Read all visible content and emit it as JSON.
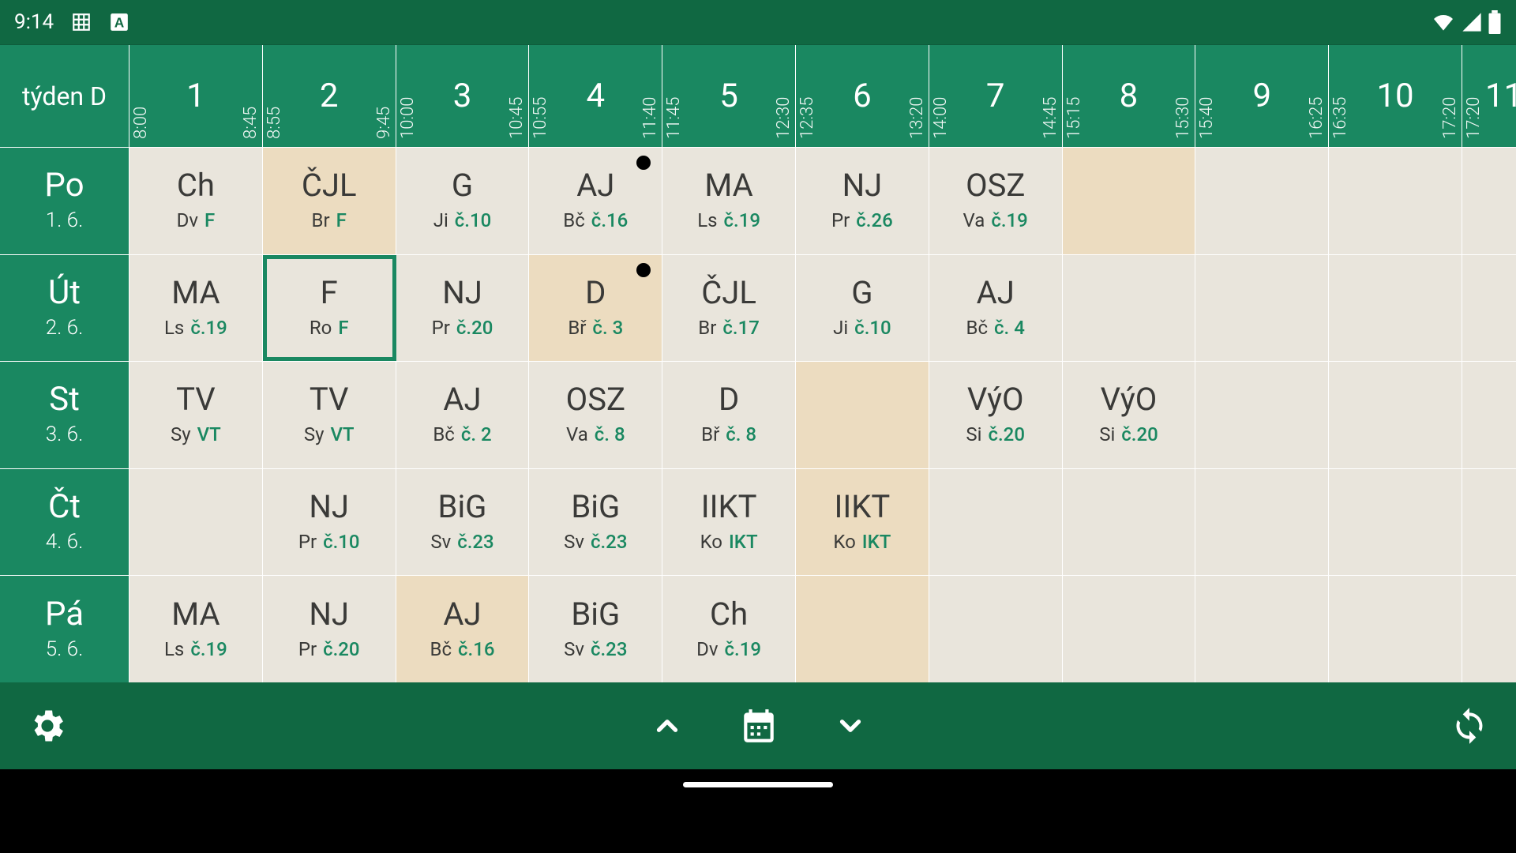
{
  "status": {
    "time": "9:14"
  },
  "header": {
    "week_label": "týden D",
    "periods": [
      {
        "num": "1",
        "start": "8:00",
        "end": "8:45",
        "narrow": false
      },
      {
        "num": "2",
        "start": "8:55",
        "end": "9:45",
        "narrow": false
      },
      {
        "num": "3",
        "start": "10:00",
        "end": "10:45",
        "narrow": false
      },
      {
        "num": "4",
        "start": "10:55",
        "end": "11:40",
        "narrow": false
      },
      {
        "num": "5",
        "start": "11:45",
        "end": "12:30",
        "narrow": false
      },
      {
        "num": "6",
        "start": "12:35",
        "end": "13:20",
        "narrow": false
      },
      {
        "num": "7",
        "start": "14:00",
        "end": "14:45",
        "narrow": false
      },
      {
        "num": "8",
        "start": "15:15",
        "end": "15:30",
        "narrow": false
      },
      {
        "num": "9",
        "start": "15:40",
        "end": "16:25",
        "narrow": false
      },
      {
        "num": "10",
        "start": "16:35",
        "end": "17:20",
        "narrow": false
      },
      {
        "num": "11",
        "start": "17:20",
        "end": "",
        "narrow": true
      }
    ]
  },
  "days": [
    {
      "name": "Po",
      "date": "1. 6.",
      "cells": [
        {
          "subj": "Ch",
          "teacher": "Dv",
          "room": "F",
          "shade": false,
          "dot": false
        },
        {
          "subj": "ČJL",
          "teacher": "Br",
          "room": "F",
          "shade": true,
          "dot": false
        },
        {
          "subj": "G",
          "teacher": "Ji",
          "room": "č.10",
          "shade": false,
          "dot": false
        },
        {
          "subj": "AJ",
          "teacher": "Bč",
          "room": "č.16",
          "shade": false,
          "dot": true
        },
        {
          "subj": "MA",
          "teacher": "Ls",
          "room": "č.19",
          "shade": false,
          "dot": false
        },
        {
          "subj": "NJ",
          "teacher": "Pr",
          "room": "č.26",
          "shade": false,
          "dot": false
        },
        {
          "subj": "OSZ",
          "teacher": "Va",
          "room": "č.19",
          "shade": false,
          "dot": false
        },
        {
          "empty": true,
          "shade": true
        },
        {
          "empty": true
        },
        {
          "empty": true
        },
        {
          "empty": true,
          "narrow": true
        }
      ]
    },
    {
      "name": "Út",
      "date": "2. 6.",
      "cells": [
        {
          "subj": "MA",
          "teacher": "Ls",
          "room": "č.19",
          "shade": false
        },
        {
          "subj": "F",
          "teacher": "Ro",
          "room": "F",
          "shade": false,
          "selected": true
        },
        {
          "subj": "NJ",
          "teacher": "Pr",
          "room": "č.20",
          "shade": false
        },
        {
          "subj": "D",
          "teacher": "Bř",
          "room": "č. 3",
          "shade": true,
          "dot": true
        },
        {
          "subj": "ČJL",
          "teacher": "Br",
          "room": "č.17",
          "shade": false
        },
        {
          "subj": "G",
          "teacher": "Ji",
          "room": "č.10",
          "shade": false
        },
        {
          "subj": "AJ",
          "teacher": "Bč",
          "room": "č. 4",
          "shade": false
        },
        {
          "empty": true
        },
        {
          "empty": true
        },
        {
          "empty": true
        },
        {
          "empty": true,
          "narrow": true
        }
      ]
    },
    {
      "name": "St",
      "date": "3. 6.",
      "cells": [
        {
          "subj": "TV",
          "teacher": "Sy",
          "room": "VT"
        },
        {
          "subj": "TV",
          "teacher": "Sy",
          "room": "VT"
        },
        {
          "subj": "AJ",
          "teacher": "Bč",
          "room": "č. 2"
        },
        {
          "subj": "OSZ",
          "teacher": "Va",
          "room": "č. 8"
        },
        {
          "subj": "D",
          "teacher": "Bř",
          "room": "č. 8"
        },
        {
          "empty": true,
          "shade": true
        },
        {
          "subj": "VýO",
          "teacher": "Si",
          "room": "č.20"
        },
        {
          "subj": "VýO",
          "teacher": "Si",
          "room": "č.20"
        },
        {
          "empty": true
        },
        {
          "empty": true
        },
        {
          "empty": true,
          "narrow": true
        }
      ]
    },
    {
      "name": "Čt",
      "date": "4. 6.",
      "cells": [
        {
          "empty": true
        },
        {
          "subj": "NJ",
          "teacher": "Pr",
          "room": "č.10"
        },
        {
          "subj": "BiG",
          "teacher": "Sv",
          "room": "č.23"
        },
        {
          "subj": "BiG",
          "teacher": "Sv",
          "room": "č.23"
        },
        {
          "subj": "IIKT",
          "teacher": "Ko",
          "room": "IKT"
        },
        {
          "subj": "IIKT",
          "teacher": "Ko",
          "room": "IKT",
          "shade": true
        },
        {
          "empty": true
        },
        {
          "empty": true
        },
        {
          "empty": true
        },
        {
          "empty": true
        },
        {
          "empty": true,
          "narrow": true
        }
      ]
    },
    {
      "name": "Pá",
      "date": "5. 6.",
      "cells": [
        {
          "subj": "MA",
          "teacher": "Ls",
          "room": "č.19"
        },
        {
          "subj": "NJ",
          "teacher": "Pr",
          "room": "č.20"
        },
        {
          "subj": "AJ",
          "teacher": "Bč",
          "room": "č.16",
          "shade": true
        },
        {
          "subj": "BiG",
          "teacher": "Sv",
          "room": "č.23"
        },
        {
          "subj": "Ch",
          "teacher": "Dv",
          "room": "č.19"
        },
        {
          "empty": true,
          "shade": true
        },
        {
          "empty": true
        },
        {
          "empty": true
        },
        {
          "empty": true
        },
        {
          "empty": true
        },
        {
          "empty": true,
          "narrow": true
        }
      ]
    }
  ]
}
